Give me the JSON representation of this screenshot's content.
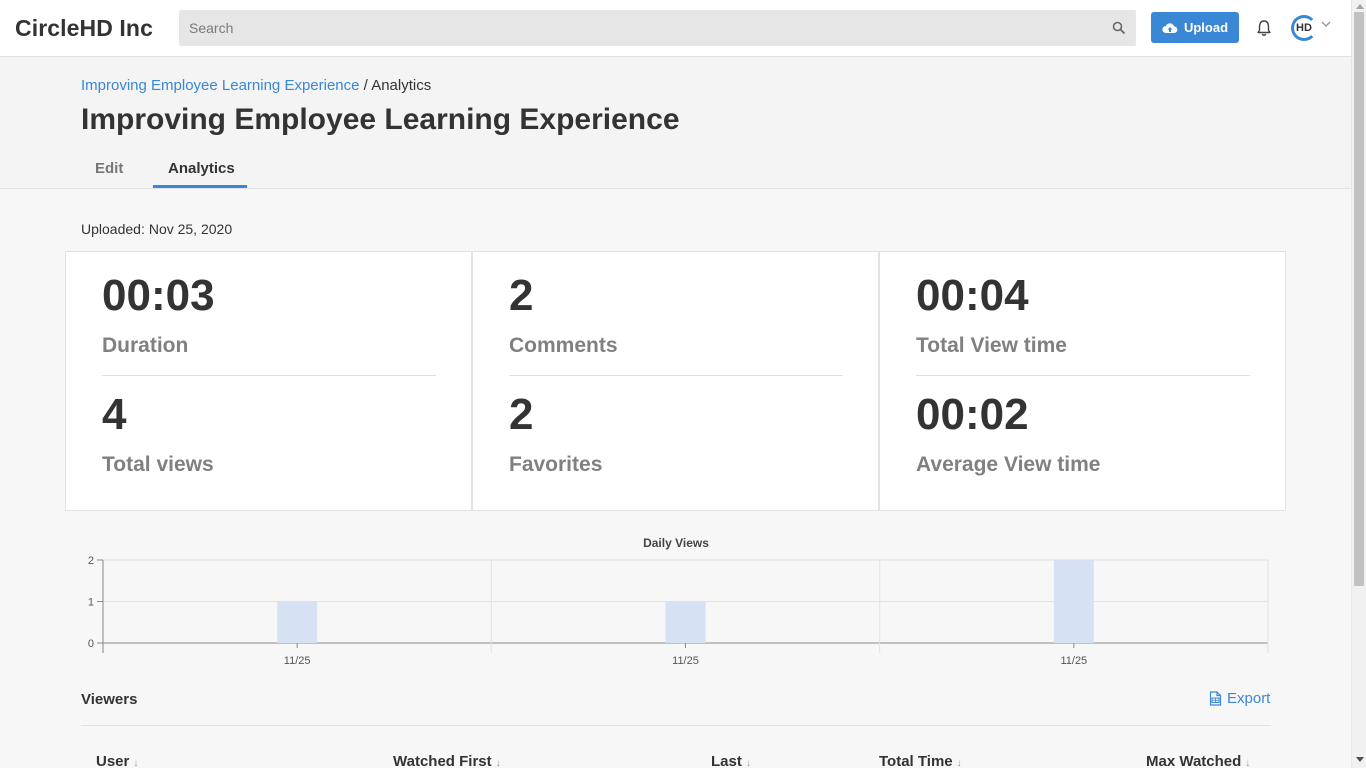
{
  "app": {
    "brand": "CircleHD Inc",
    "search_placeholder": "Search",
    "upload_label": "Upload",
    "avatar_text": "HD"
  },
  "breadcrumb": {
    "parent": "Improving Employee Learning Experience",
    "separator": "/",
    "current": "Analytics"
  },
  "page_title": "Improving Employee Learning Experience",
  "tabs": [
    {
      "label": "Edit",
      "active": false
    },
    {
      "label": "Analytics",
      "active": true
    }
  ],
  "uploaded": {
    "label": "Uploaded:",
    "date": "Nov 25, 2020"
  },
  "stats": [
    {
      "value": "00:03",
      "label": "Duration"
    },
    {
      "value": "4",
      "label": "Total views"
    },
    {
      "value": "2",
      "label": "Comments"
    },
    {
      "value": "2",
      "label": "Favorites"
    },
    {
      "value": "00:04",
      "label": "Total View time"
    },
    {
      "value": "00:02",
      "label": "Average View time"
    }
  ],
  "chart_data": {
    "type": "bar",
    "title": "Daily Views",
    "categories": [
      "11/25",
      "11/25",
      "11/25"
    ],
    "values": [
      1,
      1,
      2
    ],
    "ylim": [
      0,
      2
    ],
    "yticks": [
      "0",
      "1",
      "2"
    ],
    "grid": true,
    "bar_color": "#d6e2f3"
  },
  "viewers": {
    "title": "Viewers",
    "export_label": "Export",
    "columns": [
      "User",
      "Watched First",
      "Last",
      "Total Time",
      "Max Watched"
    ]
  },
  "colors": {
    "accent": "#3a87d6",
    "text": "#333333",
    "muted": "#808080"
  }
}
